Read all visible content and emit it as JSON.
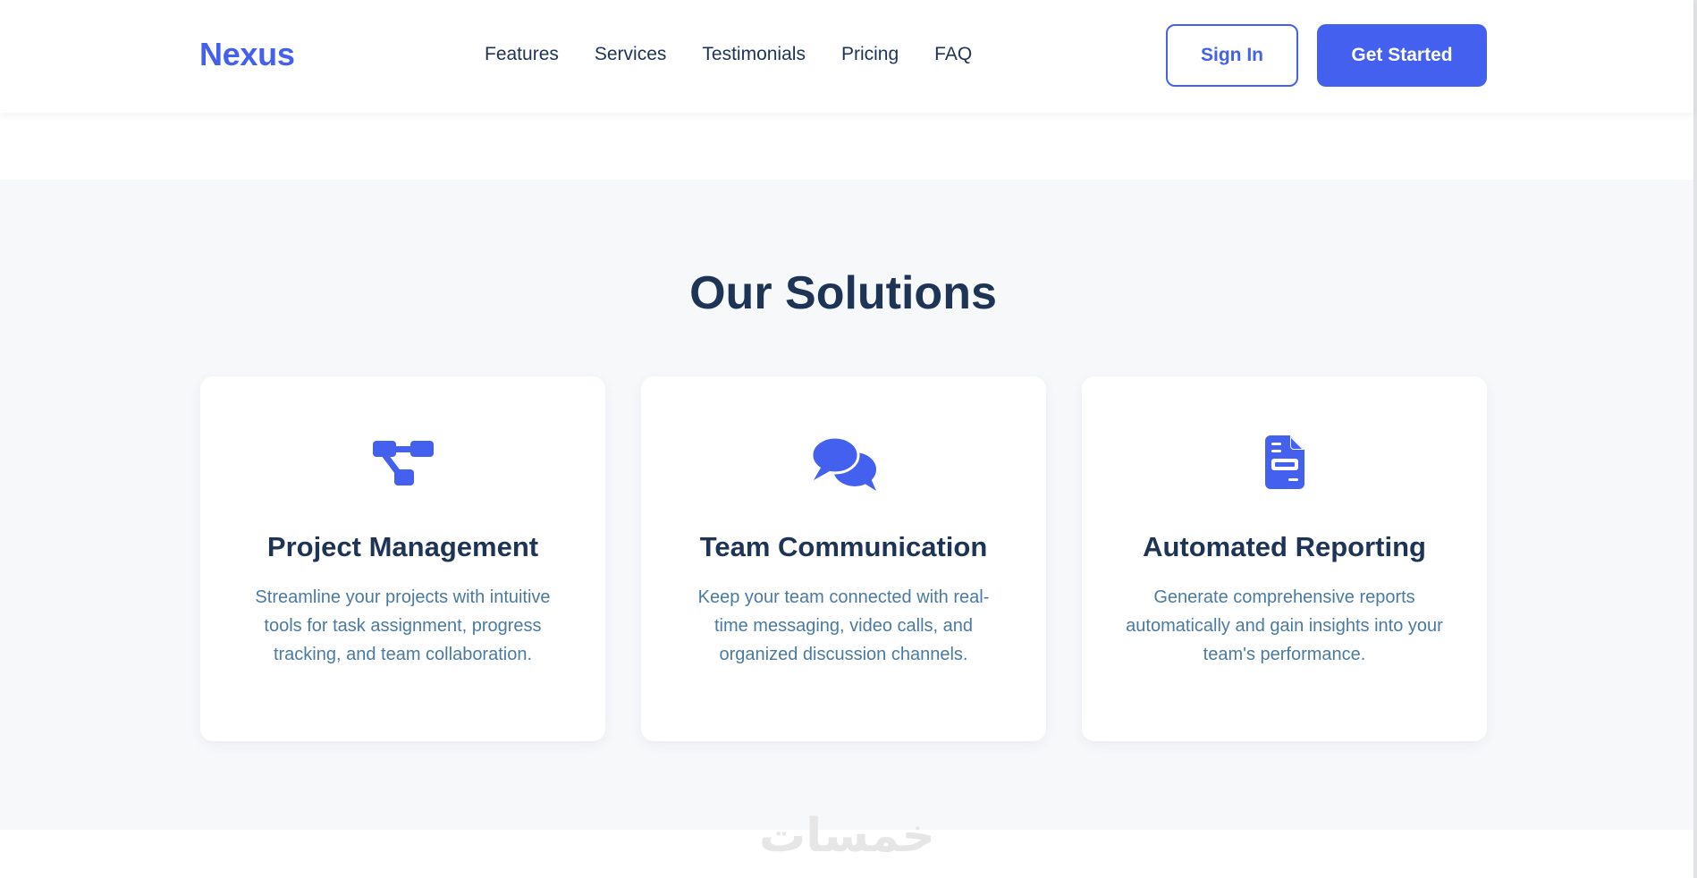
{
  "brand": {
    "logo": "Nexus",
    "accent_color": "#4361ee",
    "text_color": "#1e3456"
  },
  "nav": {
    "links": [
      "Features",
      "Services",
      "Testimonials",
      "Pricing",
      "FAQ"
    ],
    "sign_in_label": "Sign In",
    "get_started_label": "Get Started"
  },
  "solutions": {
    "title": "Our Solutions",
    "cards": [
      {
        "icon": "project-diagram-icon",
        "title": "Project Management",
        "description": "Streamline your projects with intuitive tools for task assignment, progress tracking, and team collaboration."
      },
      {
        "icon": "chat-bubbles-icon",
        "title": "Team Communication",
        "description": "Keep your team connected with real-time messaging, video calls, and organized discussion channels."
      },
      {
        "icon": "report-document-icon",
        "title": "Automated Reporting",
        "description": "Generate comprehensive reports automatically and gain insights into your team's performance."
      }
    ]
  },
  "watermark": {
    "text": "خمسات"
  }
}
